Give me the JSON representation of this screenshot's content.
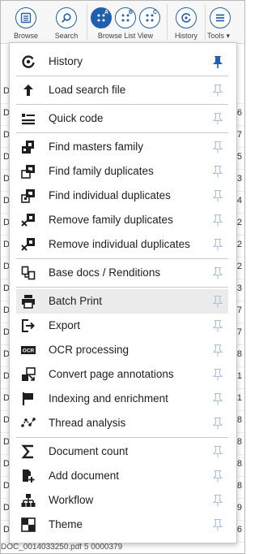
{
  "toolbar": {
    "browse": "Browse",
    "search": "Search",
    "browse_list_view": "Browse List View",
    "history": "History",
    "tools": "Tools",
    "tools_caret": "▾",
    "view_letters": [
      "A",
      "B",
      "C"
    ]
  },
  "background": {
    "left_glyph": "D",
    "rows": [
      {
        "left": "D",
        "right": ""
      },
      {
        "left": "D",
        "right": "6"
      },
      {
        "left": "D",
        "right": "7"
      },
      {
        "left": "D",
        "right": "5"
      },
      {
        "left": "D",
        "right": "3"
      },
      {
        "left": "D",
        "right": "4"
      },
      {
        "left": "D",
        "right": "2"
      },
      {
        "left": "D",
        "right": "2"
      },
      {
        "left": "D",
        "right": "2"
      },
      {
        "left": "D",
        "right": "3"
      },
      {
        "left": "D",
        "right": "7"
      },
      {
        "left": "D",
        "right": "7"
      },
      {
        "left": "D",
        "right": "8"
      },
      {
        "left": "D",
        "right": "1"
      },
      {
        "left": "D",
        "right": "1"
      },
      {
        "left": "D",
        "right": "8"
      },
      {
        "left": "D",
        "right": "8"
      },
      {
        "left": "D",
        "right": "8"
      },
      {
        "left": "D",
        "right": "8"
      },
      {
        "left": "D",
        "right": "9"
      },
      {
        "left": "D",
        "right": "6"
      }
    ],
    "bottom_text": "DOC_0014033250.pdf          5       0000379"
  },
  "menu": {
    "items": [
      {
        "label": "History",
        "icon": "history-icon",
        "pinned": true
      },
      {
        "label": "Load search file",
        "icon": "upload-arrow-icon",
        "pinned": false
      },
      {
        "label": "Quick code",
        "icon": "quick-code-icon",
        "pinned": false
      },
      {
        "label": "Find masters family",
        "icon": "find-masters-family-icon",
        "pinned": false
      },
      {
        "label": "Find family duplicates",
        "icon": "find-family-duplicates-icon",
        "pinned": false
      },
      {
        "label": "Find individual duplicates",
        "icon": "find-individual-duplicates-icon",
        "pinned": false
      },
      {
        "label": "Remove family duplicates",
        "icon": "remove-family-duplicates-icon",
        "pinned": false
      },
      {
        "label": "Remove individual duplicates",
        "icon": "remove-individual-duplicates-icon",
        "pinned": false
      },
      {
        "label": "Base docs / Renditions",
        "icon": "renditions-icon",
        "pinned": false
      },
      {
        "label": "Batch Print",
        "icon": "printer-icon",
        "pinned": false
      },
      {
        "label": "Export",
        "icon": "export-icon",
        "pinned": false
      },
      {
        "label": "OCR processing",
        "icon": "ocr-icon",
        "pinned": false
      },
      {
        "label": "Convert page annotations",
        "icon": "convert-annotations-icon",
        "pinned": false
      },
      {
        "label": "Indexing and enrichment",
        "icon": "flag-icon",
        "pinned": false
      },
      {
        "label": "Thread analysis",
        "icon": "thread-analysis-icon",
        "pinned": false
      },
      {
        "label": "Document count",
        "icon": "sigma-icon",
        "pinned": false
      },
      {
        "label": "Add document",
        "icon": "add-document-icon",
        "pinned": false
      },
      {
        "label": "Workflow",
        "icon": "workflow-icon",
        "pinned": false
      },
      {
        "label": "Theme",
        "icon": "theme-icon",
        "pinned": false
      }
    ],
    "highlighted": "Batch Print"
  },
  "colors": {
    "accent": "#1f5fb0",
    "pin_inactive": "#a9c1de",
    "pin_active": "#1f5fb0",
    "icon": "#1e1e1e"
  }
}
